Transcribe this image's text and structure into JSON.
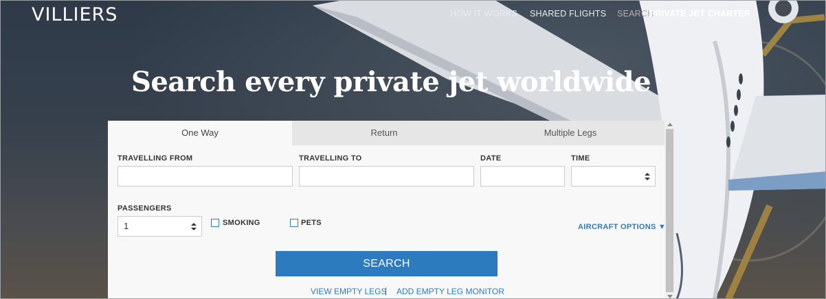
{
  "header": {
    "logo": "VILLIERS",
    "nav": {
      "how_it_works": "HOW IT WORKS",
      "shared_flights": "SHARED FLIGHTS",
      "search_prefix": "SEARCH",
      "private_jet_charter": "PRIVATE JET CHARTER"
    }
  },
  "hero": {
    "headline_start": "Search ",
    "headline_bold": "every",
    "headline_end": " private jet worldwide"
  },
  "search_panel": {
    "tabs": [
      {
        "label": "One Way",
        "active": true
      },
      {
        "label": "Return",
        "active": false
      },
      {
        "label": "Multiple Legs",
        "active": false
      }
    ],
    "fields": {
      "travelling_from": {
        "label": "TRAVELLING FROM",
        "value": ""
      },
      "travelling_to": {
        "label": "TRAVELLING TO",
        "value": ""
      },
      "date": {
        "label": "DATE",
        "value": ""
      },
      "time": {
        "label": "TIME",
        "value": ""
      },
      "passengers": {
        "label": "PASSENGERS",
        "value": "1"
      }
    },
    "options": {
      "smoking": {
        "label": "SMOKING",
        "checked": false
      },
      "pets": {
        "label": "PETS",
        "checked": false
      },
      "aircraft_options": "AIRCRAFT OPTIONS ▼"
    },
    "search_button": "SEARCH",
    "links": {
      "view_empty_legs": "VIEW EMPTY LEGS",
      "separator": "|",
      "add_empty_leg_monitor": "ADD EMPTY LEG MONITOR"
    }
  },
  "colors": {
    "accent": "#2d7bbf",
    "panel_bg": "#f8f8f8",
    "inactive_tab_bg": "#e6e6e6"
  }
}
